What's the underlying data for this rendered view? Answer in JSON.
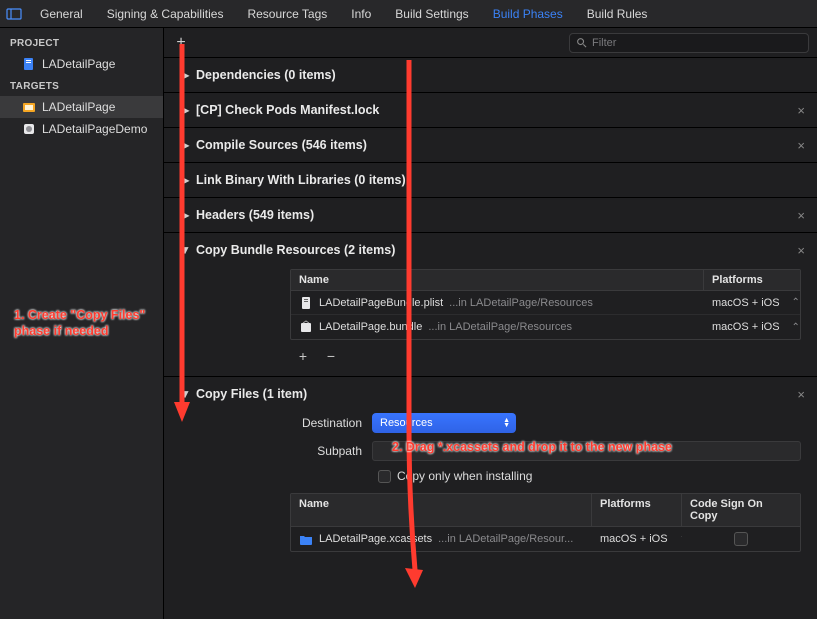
{
  "tabs": [
    "General",
    "Signing & Capabilities",
    "Resource Tags",
    "Info",
    "Build Settings",
    "Build Phases",
    "Build Rules"
  ],
  "active_tab": 5,
  "sidebar": {
    "project_label": "PROJECT",
    "project_item": "LADetailPage",
    "targets_label": "TARGETS",
    "targets": [
      "LADetailPage",
      "LADetailPageDemo"
    ],
    "selected_target": 0
  },
  "filter_placeholder": "Filter",
  "phases": {
    "deps": {
      "title": "Dependencies (0 items)",
      "expanded": false
    },
    "pods": {
      "title": "[CP] Check Pods Manifest.lock",
      "expanded": false,
      "closable": true
    },
    "compile": {
      "title": "Compile Sources (546 items)",
      "expanded": false,
      "closable": true
    },
    "link": {
      "title": "Link Binary With Libraries (0 items)",
      "expanded": false
    },
    "headers": {
      "title": "Headers (549 items)",
      "expanded": false,
      "closable": true
    },
    "copybundle": {
      "title": "Copy Bundle Resources (2 items)",
      "expanded": true,
      "closable": true,
      "columns": [
        "Name",
        "Platforms"
      ],
      "rows": [
        {
          "name": "LADetailPageBundle.plist",
          "path": "...in LADetailPage/Resources",
          "platforms": "macOS + iOS"
        },
        {
          "name": "LADetailPage.bundle",
          "path": "...in LADetailPage/Resources",
          "platforms": "macOS + iOS"
        }
      ]
    },
    "copyfiles": {
      "title": "Copy Files (1 item)",
      "expanded": true,
      "closable": true,
      "destination_label": "Destination",
      "destination_value": "Resources",
      "subpath_label": "Subpath",
      "copy_only_label": "Copy only when installing",
      "columns": [
        "Name",
        "Platforms",
        "Code Sign On Copy"
      ],
      "rows": [
        {
          "name": "LADetailPage.xcassets",
          "path": "...in LADetailPage/Resour...",
          "platforms": "macOS + iOS"
        }
      ]
    }
  },
  "annotations": {
    "a1": "1. Create \"Copy Files\"\nphase if needed",
    "a2": "2. Drag *.xcassets and drop it to the new phase"
  }
}
